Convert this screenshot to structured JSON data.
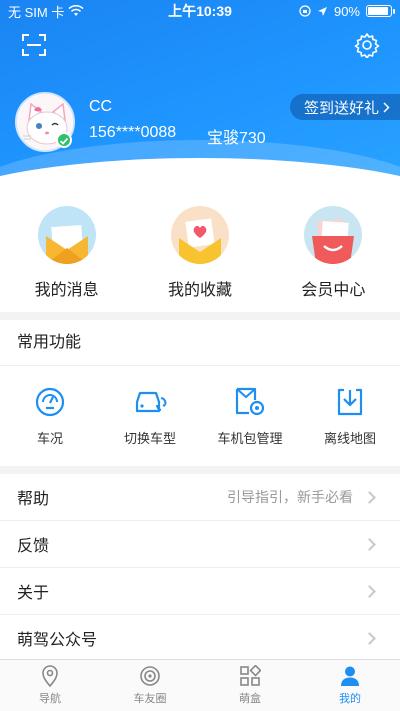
{
  "status_bar": {
    "carrier": "无 SIM 卡",
    "time": "上午10:39",
    "battery": "90%",
    "battery_level": 0.9
  },
  "profile": {
    "name": "CC",
    "phone": "156****0088",
    "car": "宝骏730",
    "signin_label": "签到送好礼"
  },
  "quick_actions": [
    {
      "label": "我的消息",
      "icon": "envelope-icon",
      "color": "#f7b733"
    },
    {
      "label": "我的收藏",
      "icon": "heart-envelope-icon",
      "color": "#f4a623"
    },
    {
      "label": "会员中心",
      "icon": "gift-bag-icon",
      "color": "#f05a5a"
    }
  ],
  "common": {
    "title": "常用功能",
    "items": [
      {
        "label": "车况",
        "icon": "speedometer-icon"
      },
      {
        "label": "切换车型",
        "icon": "car-switch-icon"
      },
      {
        "label": "车机包管理",
        "icon": "package-gear-icon"
      },
      {
        "label": "离线地图",
        "icon": "download-icon"
      }
    ]
  },
  "menu": [
    {
      "label": "帮助",
      "hint": "引导指引，新手必看"
    },
    {
      "label": "反馈",
      "hint": ""
    },
    {
      "label": "关于",
      "hint": ""
    },
    {
      "label": "萌驾公众号",
      "hint": ""
    }
  ],
  "tabs": [
    {
      "label": "导航",
      "icon": "location-pin-icon"
    },
    {
      "label": "车友圈",
      "icon": "camera-lens-icon"
    },
    {
      "label": "萌盒",
      "icon": "grid-apps-icon"
    },
    {
      "label": "我的",
      "icon": "user-icon",
      "active": true
    }
  ],
  "colors": {
    "primary": "#1f8ef1",
    "accent_green": "#2ec16b"
  }
}
